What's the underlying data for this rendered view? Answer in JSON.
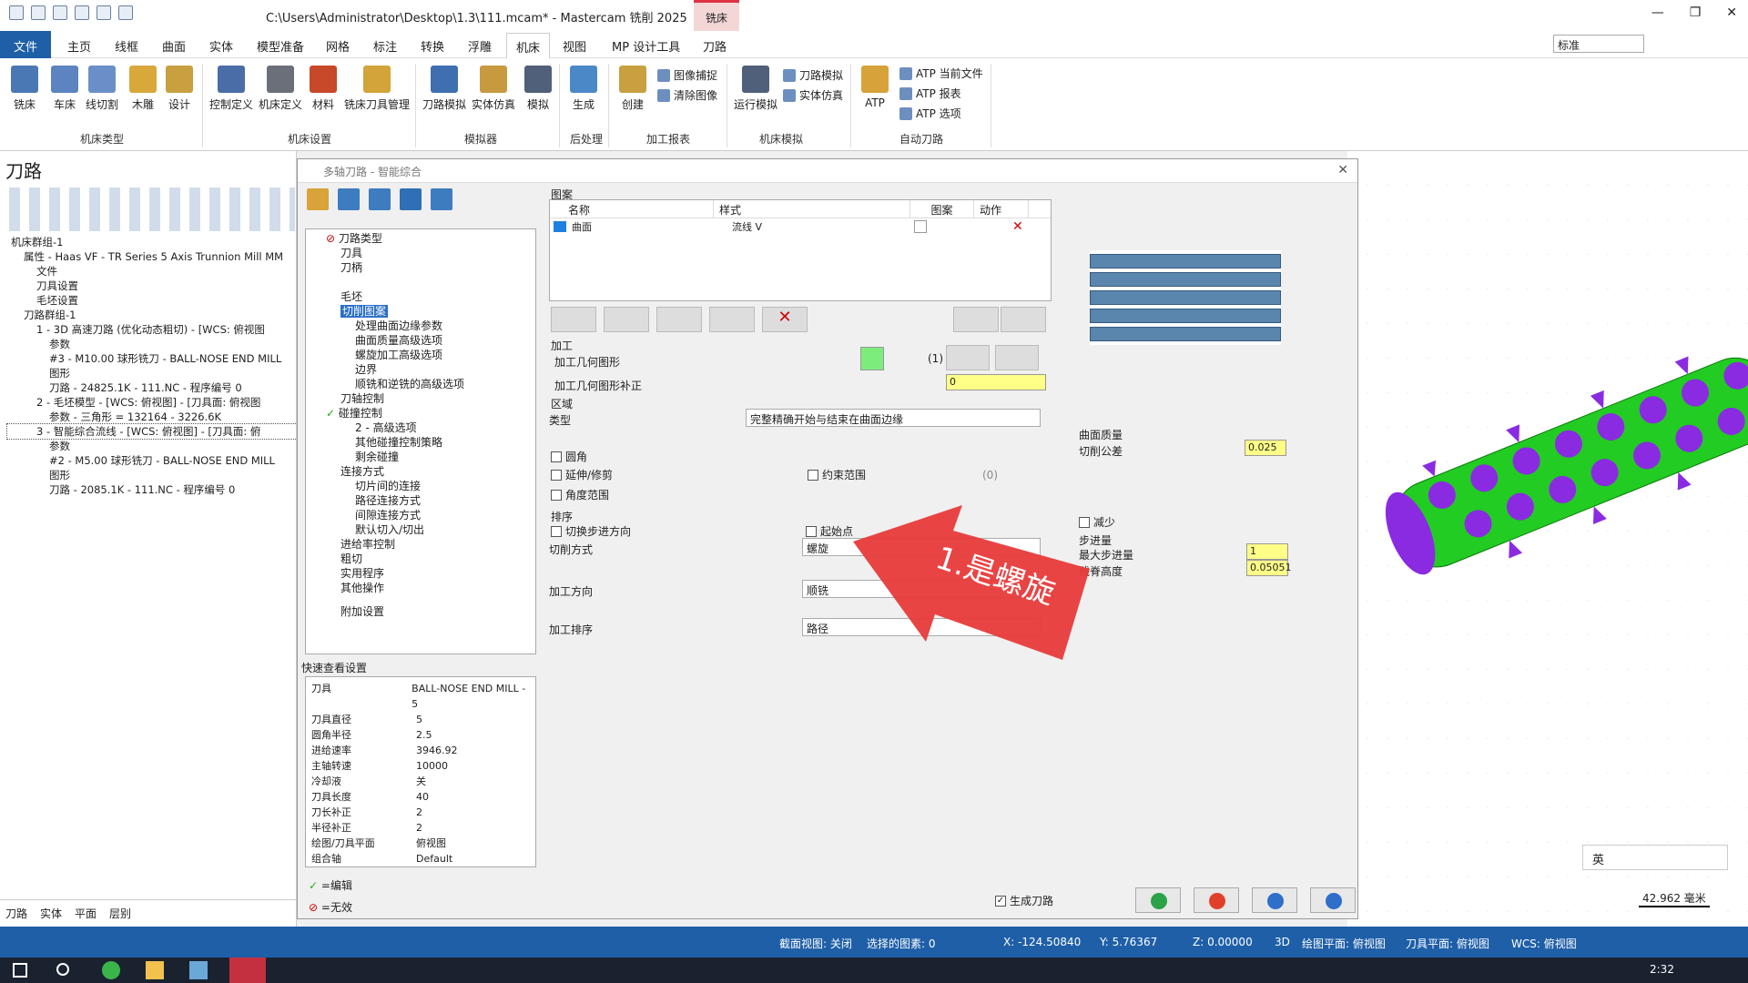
{
  "window": {
    "title": "C:\\Users\\Administrator\\Desktop\\1.3\\111.mcam* - Mastercam 铣削 2025",
    "context_tab": "铣床"
  },
  "menu": [
    "文件",
    "主页",
    "线框",
    "曲面",
    "实体",
    "模型准备",
    "网格",
    "标注",
    "转换",
    "浮雕",
    "机床",
    "视图",
    "MP 设计工具",
    "刀路"
  ],
  "style_select": "标准",
  "ribbon": {
    "groups": [
      "机床类型",
      "机床设置",
      "模拟器",
      "后处理",
      "加工报表",
      "机床模拟",
      "自动刀路"
    ],
    "buttons": [
      "铣床",
      "车床",
      "线切割",
      "木雕",
      "设计",
      "控制定义",
      "机床定义",
      "材料",
      "铣床刀具管理",
      "刀路模拟",
      "实体仿真",
      "模拟",
      "生成",
      "创建",
      "运行模拟",
      "ATP"
    ],
    "small": [
      "图像捕捉",
      "清除图像",
      "刀路模拟",
      "实体仿真",
      "ATP 当前文件",
      "ATP 报表",
      "ATP 选项"
    ]
  },
  "left_panel": {
    "title": "刀路",
    "tree": [
      "机床群组-1",
      "属性 - Haas VF - TR Series 5 Axis Trunnion Mill MM",
      "文件",
      "刀具设置",
      "毛坯设置",
      "刀路群组-1",
      "1 - 3D 高速刀路 (优化动态粗切) - [WCS: 俯视图",
      "参数",
      "#3 - M10.00 球形铣刀 - BALL-NOSE END MILL",
      "图形",
      "刀路 - 24825.1K - 111.NC - 程序编号 0",
      "2 - 毛坯模型 - [WCS: 俯视图] - [刀具面: 俯视图",
      "参数 - 三角形 = 132164 - 3226.6K",
      "3 - 智能综合流线 - [WCS: 俯视图] - [刀具面: 俯",
      "参数",
      "#2 - M5.00 球形铣刀 - BALL-NOSE END MILL",
      "图形",
      "刀路 - 2085.1K - 111.NC - 程序编号 0"
    ],
    "tabs": [
      "刀路",
      "实体",
      "平面",
      "层别"
    ]
  },
  "dialog": {
    "title": "多轴刀路 - 智能综合",
    "nav": [
      "刀路类型",
      "刀具",
      "刀柄",
      "毛坯",
      "切削图案",
      "处理曲面边缘参数",
      "曲面质量高级选项",
      "螺旋加工高级选项",
      "边界",
      "顺铣和逆铣的高级选项",
      "刀轴控制",
      "碰撞控制",
      "2 - 高级选项",
      "其他碰撞控制策略",
      "剩余碰撞",
      "连接方式",
      "切片间的连接",
      "路径连接方式",
      "间隙连接方式",
      "默认切入/切出",
      "进给率控制",
      "粗切",
      "实用程序",
      "其他操作",
      "附加设置"
    ],
    "quickview_title": "快速查看设置",
    "quickview": [
      [
        "刀具",
        "BALL-NOSE END MILL - 5"
      ],
      [
        "刀具直径",
        "5"
      ],
      [
        "圆角半径",
        "2.5"
      ],
      [
        "进给速率",
        "3946.92"
      ],
      [
        "主轴转速",
        "10000"
      ],
      [
        "冷却液",
        "关"
      ],
      [
        "刀具长度",
        "40"
      ],
      [
        "刀长补正",
        "2"
      ],
      [
        "半径补正",
        "2"
      ],
      [
        "绘图/刀具平面",
        "俯视图"
      ],
      [
        "组合轴",
        "Default"
      ]
    ],
    "legend": [
      "=编辑",
      "=无效"
    ],
    "pattern": {
      "label": "图案",
      "cols": [
        "名称",
        "样式",
        "图案",
        "动作"
      ],
      "row_name": "曲面",
      "row_style": "流线 V"
    },
    "machining": {
      "label": "加工",
      "geom": "加工几何图形",
      "geom_count": "(1)",
      "offset_label": "加工几何图形补正",
      "offset": "0"
    },
    "region": {
      "label": "区域",
      "type_label": "类型",
      "type": "完整精确开始与结束在曲面边缘",
      "fillet": "圆角",
      "extend": "延伸/修剪",
      "angle": "角度范围",
      "bound": "约束范围",
      "bound_count": "(0)"
    },
    "sort": {
      "label": "排序",
      "switch": "切换步进方向",
      "start": "起始点",
      "cut_label": "切削方式",
      "cut": "螺旋",
      "dir_label": "加工方向",
      "dir": "顺铣",
      "order_label": "加工排序",
      "order": "路径"
    },
    "quality": {
      "label": "曲面质量",
      "tol_label": "切削公差",
      "tol": "0.025",
      "reduce": "减少"
    },
    "step": {
      "label": "步进量",
      "max_label": "最大步进量",
      "max": "1",
      "scallop_label": "残脊高度",
      "scallop": "0.05051"
    },
    "generate": "生成刀路",
    "annotation": "1.是螺旋"
  },
  "status": {
    "section": "截面视图: 关闭",
    "selected": "选择的图素: 0",
    "x": "X: -124.50840",
    "y": "Y: 5.76367",
    "z": "Z: 0.00000",
    "mode": "3D",
    "cplane": "绘图平面: 俯视图",
    "tplane": "刀具平面: 俯视图",
    "wcs": "WCS: 俯视图"
  },
  "scale": "42.962 毫米",
  "ime": "英",
  "clock": "2:32",
  "colors": {
    "accent": "#1e5fa8",
    "part": "#22cc22",
    "bumps": "#8a2be2",
    "arrow": "#e83a3a"
  }
}
